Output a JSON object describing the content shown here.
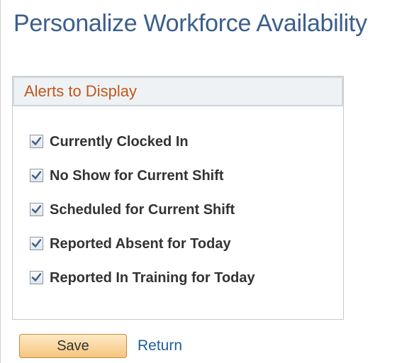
{
  "page": {
    "title": "Personalize Workforce Availability"
  },
  "alerts_group": {
    "header": "Alerts to Display",
    "items": [
      {
        "label": "Currently Clocked In",
        "checked": true
      },
      {
        "label": "No Show for Current Shift",
        "checked": true
      },
      {
        "label": "Scheduled for Current Shift",
        "checked": true
      },
      {
        "label": "Reported Absent for Today",
        "checked": true
      },
      {
        "label": "Reported In Training for Today",
        "checked": true
      }
    ]
  },
  "footer": {
    "save_label": "Save",
    "return_label": "Return"
  },
  "colors": {
    "title": "#3b5e8c",
    "group_header_text": "#c0571b",
    "link": "#1d5fa0",
    "save_button": "#f6c57d"
  }
}
